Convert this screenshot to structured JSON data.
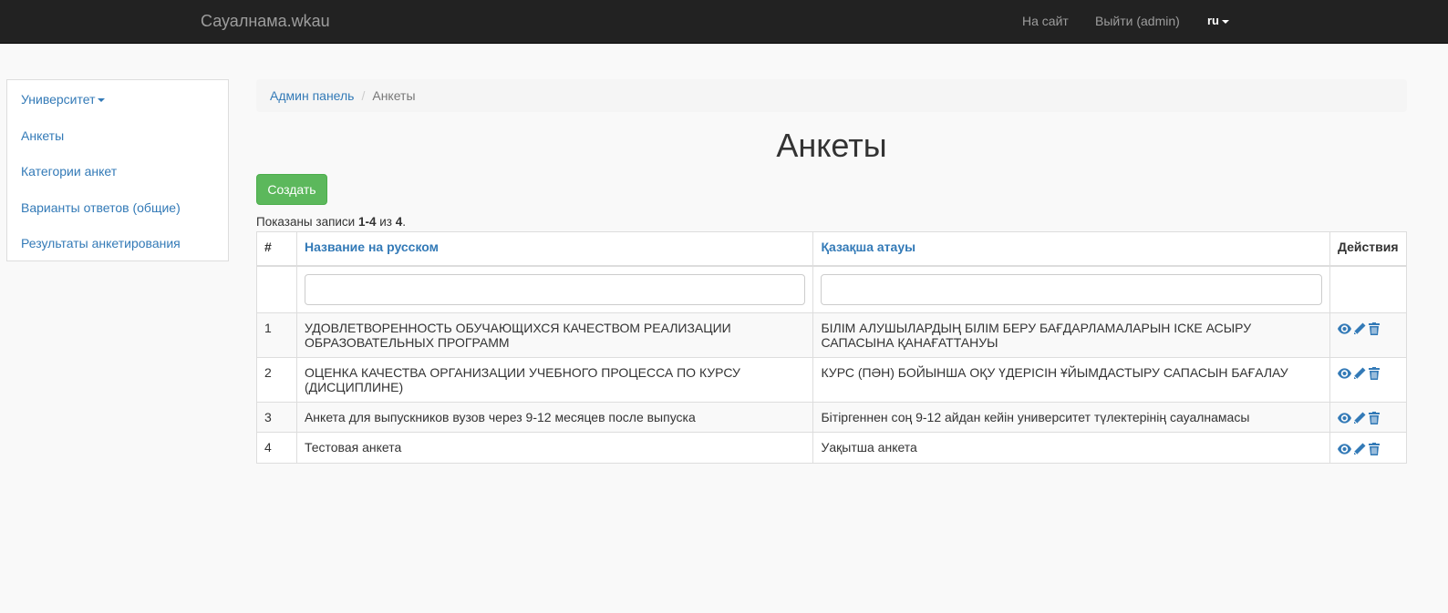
{
  "navbar": {
    "brand": "Сауалнама.wkau",
    "site_link": "На сайт",
    "logout_link": "Выйти (admin)",
    "lang": "ru"
  },
  "sidebar": {
    "items": [
      {
        "label": "Университет"
      },
      {
        "label": "Анкеты"
      },
      {
        "label": "Категории анкет"
      },
      {
        "label": "Варианты ответов (общие)"
      },
      {
        "label": "Результаты анкетирования"
      }
    ]
  },
  "breadcrumb": {
    "home": "Админ панель",
    "current": "Анкеты"
  },
  "page": {
    "title": "Анкеты",
    "create_button": "Создать",
    "summary_prefix": "Показаны записи ",
    "summary_range": "1-4",
    "summary_mid": " из ",
    "summary_total": "4",
    "summary_suffix": "."
  },
  "table": {
    "headers": {
      "num": "#",
      "name_ru": "Название на русском",
      "name_kz": "Қазақша атауы",
      "actions": "Действия"
    },
    "rows": [
      {
        "num": "1",
        "ru": "УДОВЛЕТВОРЕННОСТЬ ОБУЧАЮЩИХСЯ КАЧЕСТВОМ РЕАЛИЗАЦИИ ОБРАЗОВАТЕЛЬНЫХ ПРОГРАММ",
        "kz": "БІЛІМ АЛУШЫЛАРДЫҢ БІЛІМ БЕРУ БАҒДАРЛАМАЛАРЫН ІСКЕ АСЫРУ САПАСЫНА ҚАНАҒАТТАНУЫ"
      },
      {
        "num": "2",
        "ru": "ОЦЕНКА КАЧЕСТВА ОРГАНИЗАЦИИ УЧЕБНОГО ПРОЦЕССА ПО КУРСУ (ДИСЦИПЛИНЕ)",
        "kz": "КУРС (ПӘН) БОЙЫНША ОҚУ ҮДЕРІСІН ҰЙЫМДАСТЫРУ САПАСЫН БАҒАЛАУ"
      },
      {
        "num": "3",
        "ru": "Анкета для выпускников вузов через 9-12 месяцев после выпуска",
        "kz": "Бітіргеннен соң 9-12 айдан кейін университет түлектерінің сауалнамасы"
      },
      {
        "num": "4",
        "ru": "Тестовая анкета",
        "kz": "Уақытша анкета"
      }
    ]
  },
  "colors": {
    "navbar_bg": "#222222",
    "link": "#337ab7",
    "create_btn": "#5cb85c"
  },
  "icons": [
    "view-icon",
    "edit-icon",
    "delete-icon"
  ]
}
